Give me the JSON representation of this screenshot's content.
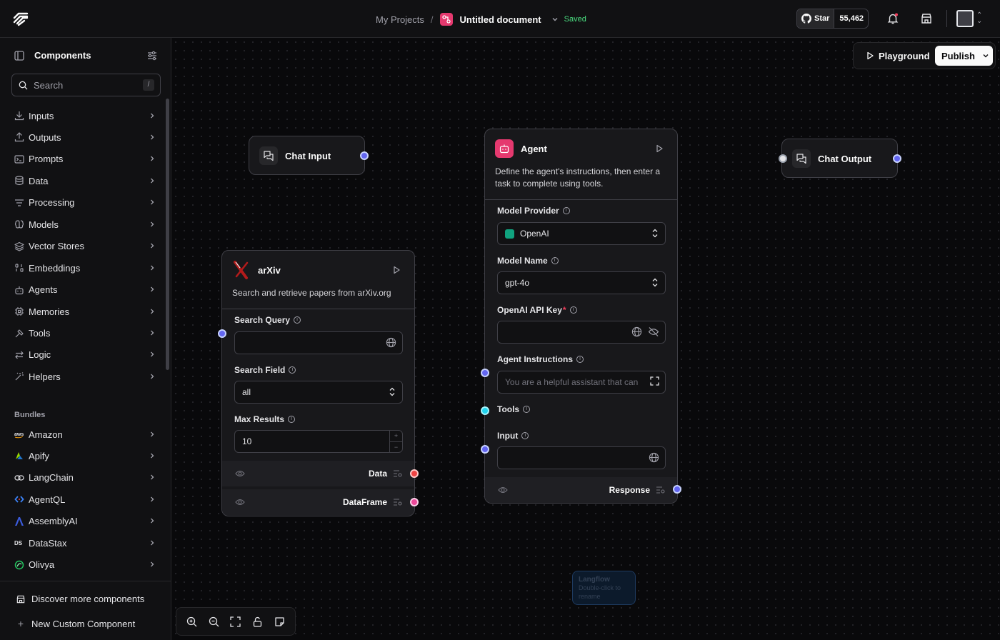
{
  "header": {
    "project_link": "My Projects",
    "separator": "/",
    "document_title": "Untitled document",
    "save_status": "Saved",
    "github_star_label": "Star",
    "github_star_count": "55,462"
  },
  "sidebar": {
    "title": "Components",
    "search_placeholder": "Search",
    "search_shortcut": "/",
    "categories": [
      {
        "label": "Inputs",
        "icon": "download-icon"
      },
      {
        "label": "Outputs",
        "icon": "upload-icon"
      },
      {
        "label": "Prompts",
        "icon": "terminal-icon"
      },
      {
        "label": "Data",
        "icon": "database-icon"
      },
      {
        "label": "Processing",
        "icon": "list-filter-icon"
      },
      {
        "label": "Models",
        "icon": "brain-icon"
      },
      {
        "label": "Vector Stores",
        "icon": "layers-icon"
      },
      {
        "label": "Embeddings",
        "icon": "binary-icon"
      },
      {
        "label": "Agents",
        "icon": "bot-icon"
      },
      {
        "label": "Memories",
        "icon": "cpu-icon"
      },
      {
        "label": "Tools",
        "icon": "hammer-icon"
      },
      {
        "label": "Logic",
        "icon": "arrows-icon"
      },
      {
        "label": "Helpers",
        "icon": "wand-icon"
      }
    ],
    "bundles_label": "Bundles",
    "bundles": [
      {
        "label": "Amazon",
        "icon": "aws-icon"
      },
      {
        "label": "Apify",
        "icon": "apify-icon"
      },
      {
        "label": "LangChain",
        "icon": "langchain-icon"
      },
      {
        "label": "AgentQL",
        "icon": "agentql-icon"
      },
      {
        "label": "AssemblyAI",
        "icon": "assemblyai-icon"
      },
      {
        "label": "DataStax",
        "icon": "datastax-icon"
      },
      {
        "label": "Olivya",
        "icon": "olivya-icon"
      }
    ],
    "discover_label": "Discover more components",
    "new_custom_label": "New Custom Component"
  },
  "toolbar": {
    "playground_label": "Playground",
    "publish_label": "Publish"
  },
  "nodes": {
    "chat_input": {
      "title": "Chat Input"
    },
    "chat_output": {
      "title": "Chat Output"
    },
    "arxiv": {
      "title": "arXiv",
      "description": "Search and retrieve papers from arXiv.org",
      "search_query_label": "Search Query",
      "search_query_value": "",
      "search_field_label": "Search Field",
      "search_field_value": "all",
      "max_results_label": "Max Results",
      "max_results_value": "10",
      "output_data": "Data",
      "output_dataframe": "DataFrame"
    },
    "agent": {
      "title": "Agent",
      "description": "Define the agent's instructions, then enter a task to complete using tools.",
      "model_provider_label": "Model Provider",
      "model_provider_value": "OpenAI",
      "model_name_label": "Model Name",
      "model_name_value": "gpt-4o",
      "api_key_label": "OpenAI API Key",
      "api_key_required": "*",
      "instructions_label": "Agent Instructions",
      "instructions_value": "You are a helpful assistant that can",
      "tools_label": "Tools",
      "input_label": "Input",
      "output_response": "Response"
    }
  },
  "note": {
    "title": "Langflow",
    "subtitle": "Double-click to rename"
  },
  "colors": {
    "accent_blue": "#6366f1",
    "data_red": "#ef4444",
    "dataframe_pink": "#ec4899",
    "tools_cyan": "#22d3ee",
    "saved_green": "#4ade80",
    "brand_pink": "#e5396f"
  }
}
